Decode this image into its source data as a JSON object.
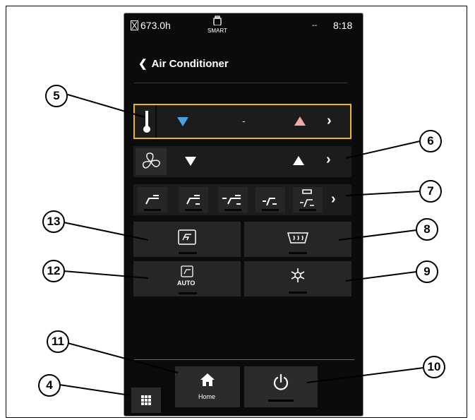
{
  "status_bar": {
    "hours": "673.0h",
    "engine_mode": "SMART",
    "dashes": "--",
    "time": "8:18"
  },
  "header": {
    "back_icon": "chevron-left-icon",
    "title": "Air Conditioner"
  },
  "temperature_row": {
    "icon": "thermometer-icon",
    "value": "-",
    "down_color": "#4aa3e0",
    "up_color": "#f3a9a9",
    "highlight_color": "#f0b323"
  },
  "fan_row": {
    "icon": "fan-icon"
  },
  "airflow_modes": [
    {
      "icon": "airflow-face-icon"
    },
    {
      "icon": "airflow-face-feet-icon"
    },
    {
      "icon": "airflow-face-feet-side-icon"
    },
    {
      "icon": "airflow-feet-icon"
    },
    {
      "icon": "airflow-defrost-feet-icon"
    }
  ],
  "tiles": {
    "recirculation": {
      "icon": "recirculation-icon"
    },
    "rear_defrost": {
      "icon": "rear-defroster-icon"
    },
    "auto_mode": {
      "icon": "auto-climate-icon",
      "label": "AUTO"
    },
    "ac_compressor": {
      "icon": "snowflake-icon"
    }
  },
  "bottom_bar": {
    "home_label": "Home",
    "home_icon": "home-icon",
    "power_icon": "power-icon",
    "menu_icon": "grid-menu-icon"
  },
  "callouts": [
    "5",
    "6",
    "7",
    "13",
    "8",
    "12",
    "9",
    "11",
    "10",
    "4"
  ]
}
